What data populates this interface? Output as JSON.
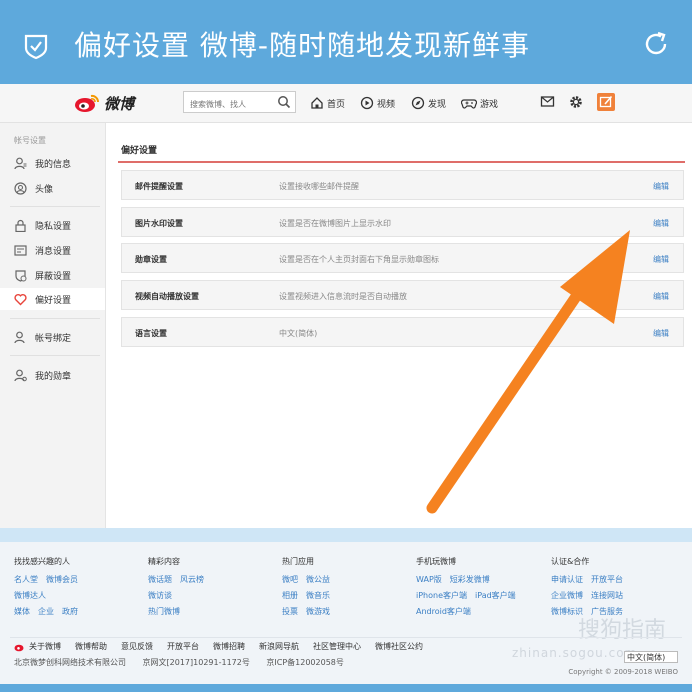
{
  "app_bar": {
    "title": "偏好设置 微博-随时随地发现新鲜事"
  },
  "topnav": {
    "logo_text": "微博",
    "search_placeholder": "搜索微博、找人",
    "items": [
      {
        "label": "首页",
        "icon": "home-icon"
      },
      {
        "label": "视频",
        "icon": "video-icon"
      },
      {
        "label": "发现",
        "icon": "discover-icon"
      },
      {
        "label": "游戏",
        "icon": "game-icon"
      }
    ],
    "accent": "#f0813a"
  },
  "sidebar": {
    "section": "帐号设置",
    "items": [
      {
        "label": "我的信息",
        "icon": "user-info-icon"
      },
      {
        "label": "头像",
        "icon": "avatar-icon"
      },
      {
        "label": "隐私设置",
        "icon": "lock-icon"
      },
      {
        "label": "消息设置",
        "icon": "message-icon"
      },
      {
        "label": "屏蔽设置",
        "icon": "block-icon"
      },
      {
        "label": "偏好设置",
        "icon": "preference-icon",
        "active": true
      },
      {
        "label": "帐号绑定",
        "icon": "account-bind-icon"
      },
      {
        "label": "我的勋章",
        "icon": "medal-icon"
      }
    ]
  },
  "main": {
    "title": "偏好设置",
    "rows": [
      {
        "label": "邮件提醒设置",
        "desc": "设置接收哪些邮件提醒",
        "action": "编辑"
      },
      {
        "label": "图片水印设置",
        "desc": "设置是否在微博图片上显示水印",
        "action": "编辑"
      },
      {
        "label": "勋章设置",
        "desc": "设置是否在个人主页封面右下角显示勋章图标",
        "action": "编辑"
      },
      {
        "label": "视频自动播放设置",
        "desc": "设置视频进入信息流时是否自动播放",
        "action": "编辑"
      },
      {
        "label": "语言设置",
        "desc": "中文(简体)",
        "action": "编辑"
      }
    ]
  },
  "footer": {
    "columns": [
      {
        "title": "找找感兴趣的人",
        "rows": [
          [
            "名人堂",
            "微博会员"
          ],
          [
            "微博达人"
          ],
          [
            "媒体",
            "企业",
            "政府"
          ]
        ]
      },
      {
        "title": "精彩内容",
        "rows": [
          [
            "微话题",
            "风云榜"
          ],
          [
            "微访谈"
          ],
          [
            "热门微博"
          ]
        ]
      },
      {
        "title": "热门应用",
        "rows": [
          [
            "微吧",
            "微公益"
          ],
          [
            "相册",
            "微音乐"
          ],
          [
            "投票",
            "微游戏"
          ]
        ]
      },
      {
        "title": "手机玩微博",
        "rows": [
          [
            "WAP版",
            "短彩发微博"
          ],
          [
            "iPhone客户端",
            "iPad客户端"
          ],
          [
            "Android客户端"
          ]
        ]
      },
      {
        "title": "认证&合作",
        "rows": [
          [
            "申请认证",
            "开放平台"
          ],
          [
            "企业微博",
            "连接网站"
          ],
          [
            "微博标识",
            "广告服务"
          ]
        ]
      }
    ],
    "links": [
      "关于微博",
      "微博帮助",
      "意见反馈",
      "开放平台",
      "微博招聘",
      "新浪网导航",
      "社区管理中心",
      "微博社区公约"
    ],
    "company": [
      "北京微梦创科网络技术有限公司",
      "京网文[2017]10291-1172号",
      "京ICP备12002058号"
    ],
    "language": "中文(简体)",
    "copyright": "Copyright © 2009-2018 WEIBO",
    "watermark": "搜狗指南",
    "watermark_url": "zhinan.sogou.com"
  },
  "colors": {
    "app_bar": "#5ea9dc",
    "link": "#3b7fc4",
    "arrow": "#f58220",
    "divider_red": "#d9534f"
  }
}
